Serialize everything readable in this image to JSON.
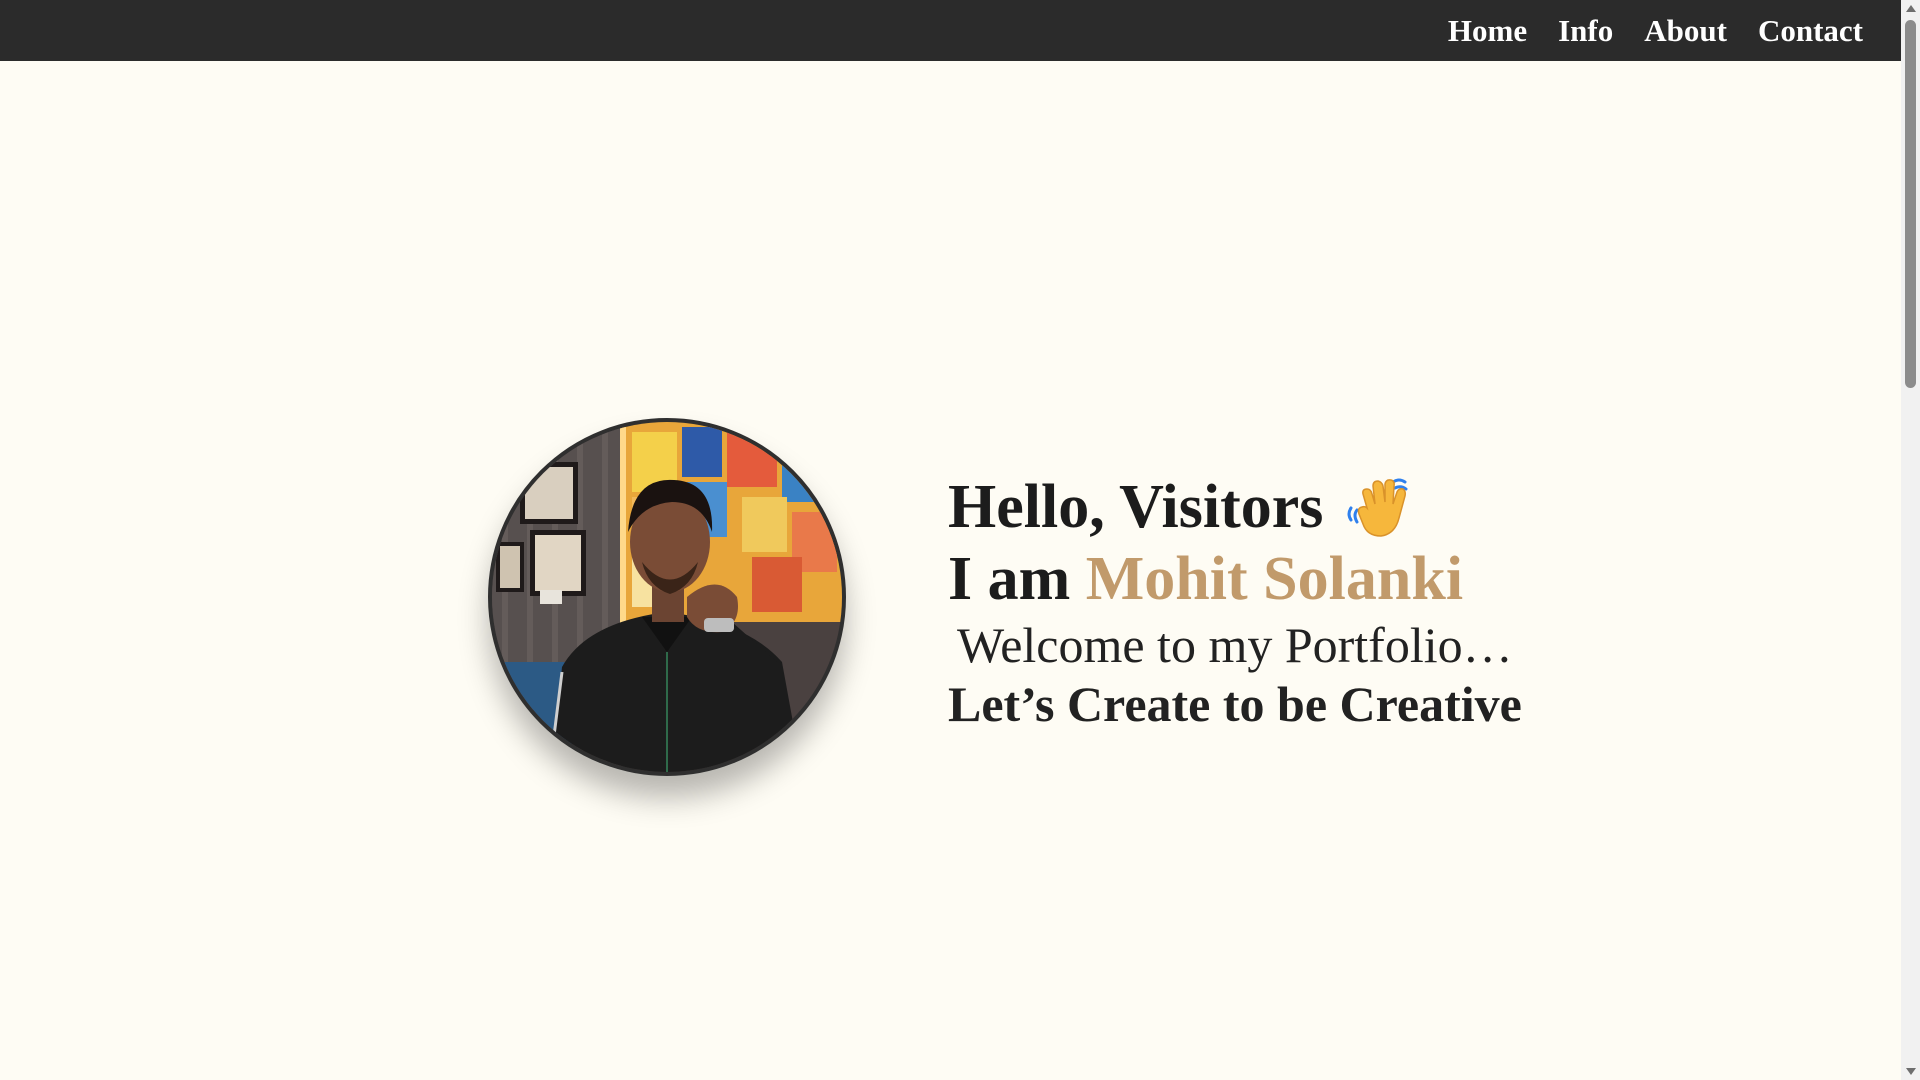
{
  "nav": {
    "items": [
      {
        "label": "Home"
      },
      {
        "label": "Info"
      },
      {
        "label": "About"
      },
      {
        "label": "Contact"
      }
    ]
  },
  "hero": {
    "greeting": "Hello, Visitors",
    "greeting_icon": "waving-hand-icon",
    "name_prefix": "I am",
    "name": "Mohit Solanki",
    "welcome": "Welcome to my Portfolio…",
    "tagline": "Let’s Create to be Creative",
    "avatar_icon": "profile-photo"
  },
  "colors": {
    "navbar_bg": "#2b2b2b",
    "page_bg": "#fefcf4",
    "name_accent": "#c19a6b",
    "text": "#1c1c1c"
  }
}
